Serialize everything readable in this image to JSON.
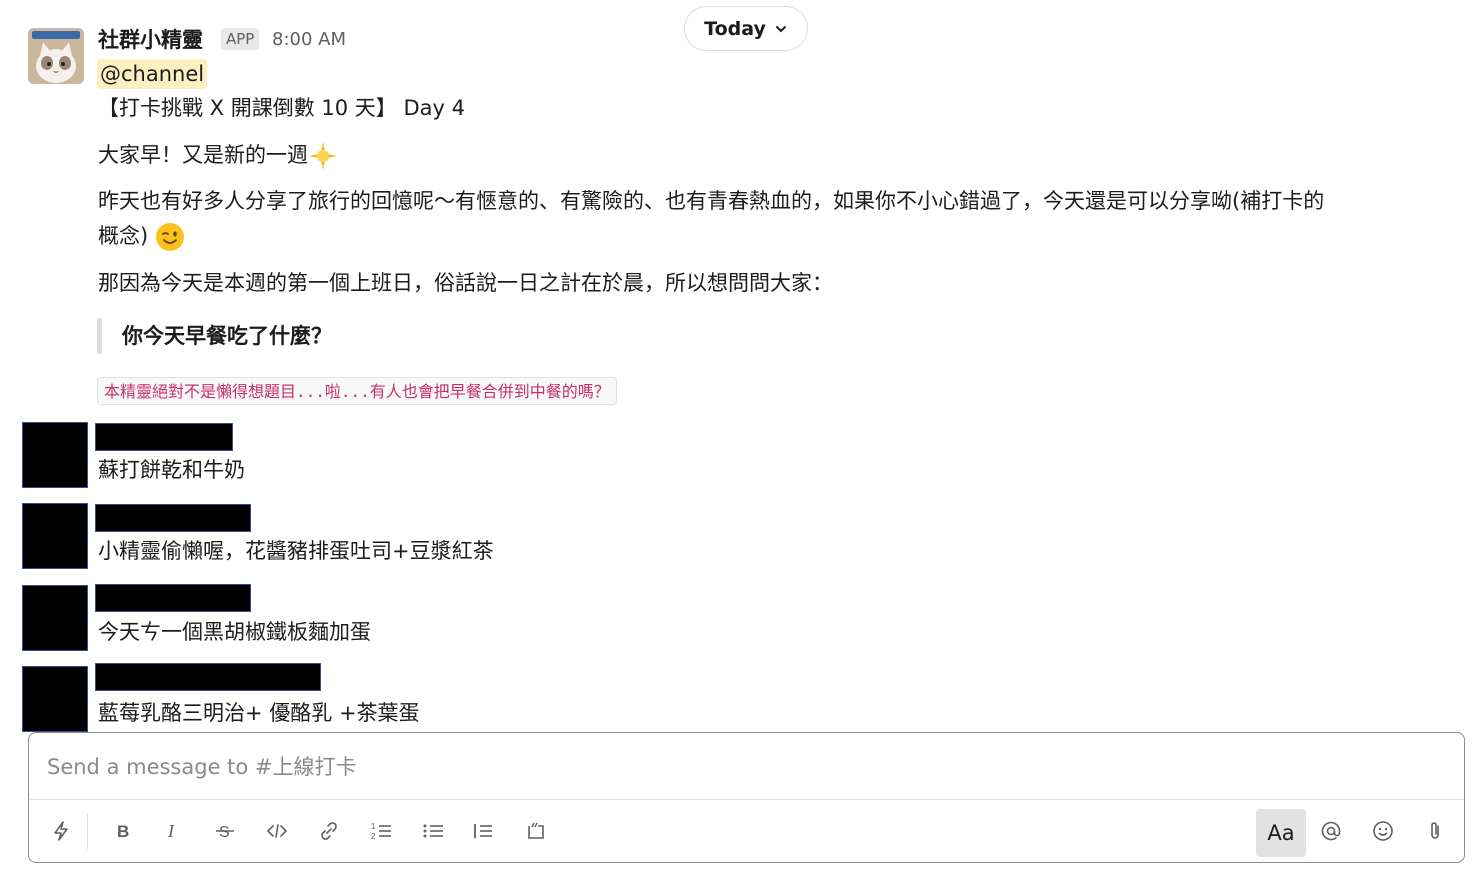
{
  "date_divider": {
    "label": "Today"
  },
  "bot_message": {
    "sender": "社群小精靈",
    "badge": "APP",
    "time": "8:00 AM",
    "mention": "@channel",
    "title_line": "【打卡挑戰 X 開課倒數 10 天】 Day 4",
    "greeting": "大家早！又是新的一週",
    "paragraph_line1": "昨天也有好多人分享了旅行的回憶呢～有愜意的、有驚險的、也有青春熱血的，如果你不小心錯過了，今天還是可以分享呦(補打卡的",
    "paragraph_line2": "概念)",
    "question_intro": "那因為今天是本週的第一個上班日，俗話說一日之計在於晨，所以想問問大家：",
    "quote": "你今天早餐吃了什麼？",
    "code_note": "本精靈絕對不是懶得想題目...啦...有人也會把早餐合併到中餐的嗎？"
  },
  "replies": [
    {
      "text": "蘇打餅乾和牛奶"
    },
    {
      "text": "小精靈偷懶喔，花醬豬排蛋吐司+豆漿紅茶"
    },
    {
      "text": "今天ㄘ一個黑胡椒鐵板麵加蛋"
    },
    {
      "text": "藍莓乳酪三明治+ 優酪乳 +茶葉蛋"
    }
  ],
  "composer": {
    "placeholder": "Send a message to #上線打卡",
    "format_button": "Aa"
  }
}
